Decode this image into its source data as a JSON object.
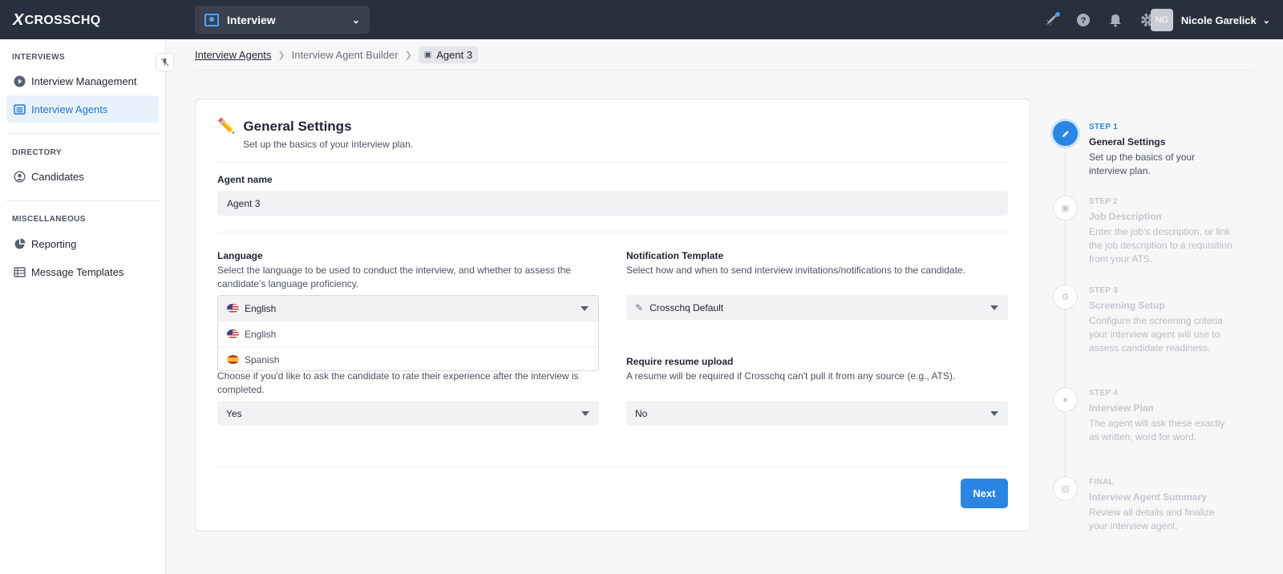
{
  "app": {
    "logo_text": "CROSSCHQ",
    "logo_mark": "X"
  },
  "topbar": {
    "switcher_label": "Interview",
    "user_initials": "NG",
    "user_name": "Nicole Garelick"
  },
  "sidebar": {
    "sections": [
      {
        "title": "INTERVIEWS"
      },
      {
        "title": "DIRECTORY"
      },
      {
        "title": "MISCELLANEOUS"
      }
    ],
    "items": [
      {
        "label": "Interview Management",
        "icon": "play-circle-icon",
        "active": false
      },
      {
        "label": "Interview Agents",
        "icon": "list-icon",
        "active": true
      },
      {
        "label": "Candidates",
        "icon": "user-circle-icon",
        "active": false
      },
      {
        "label": "Reporting",
        "icon": "pie-chart-icon",
        "active": false
      },
      {
        "label": "Message Templates",
        "icon": "table-icon",
        "active": false
      }
    ]
  },
  "breadcrumb": {
    "items": [
      "Interview Agents",
      "Interview Agent Builder",
      "Agent 3"
    ]
  },
  "card": {
    "title": "General Settings",
    "subtitle": "Set up the basics of your interview plan.",
    "agent_name_label": "Agent name",
    "agent_name_value": "Agent 3",
    "language_label": "Language",
    "language_desc": "Select the language to be used to conduct the interview, and whether to assess the candidate's language proficiency.",
    "language_value": "English",
    "language_options": [
      "English",
      "Spanish"
    ],
    "notification_label": "Notification Template",
    "notification_desc": "Select how and when to send interview invitations/notifications to the candidate.",
    "notification_value": "Crosschq Default",
    "rating_desc": "Choose if you'd like to ask the candidate to rate their experience after the interview is completed.",
    "rating_value": "Yes",
    "resume_label": "Require resume upload",
    "resume_desc": "A resume will be required if Crosschq can't pull it from any source (e.g., ATS).",
    "resume_value": "No",
    "next_label": "Next"
  },
  "stepper": {
    "steps": [
      {
        "num": "STEP 1",
        "title": "General Settings",
        "desc": "Set up the basics of your interview plan.",
        "icon": "pencil-icon",
        "active": true
      },
      {
        "num": "STEP 2",
        "title": "Job Description",
        "desc": "Enter the job's description, or link the job description to a requisition from your ATS.",
        "icon": "briefcase-icon",
        "active": false
      },
      {
        "num": "STEP 3",
        "title": "Screening Setup",
        "desc": "Configure the screening criteria your interview agent will use to assess candidate readiness.",
        "icon": "gear-icon",
        "active": false
      },
      {
        "num": "STEP 4",
        "title": "Interview Plan",
        "desc": "The agent will ask these exactly as written, word for word.",
        "icon": "chat-icon",
        "active": false
      },
      {
        "num": "FINAL",
        "title": "Interview Agent Summary",
        "desc": "Review all details and finalize your interview agent.",
        "icon": "summary-icon",
        "active": false
      }
    ]
  },
  "colors": {
    "topbar": "#2a2f3d",
    "accent": "#2a86e2",
    "active_nav_bg": "#e8f2fd"
  }
}
